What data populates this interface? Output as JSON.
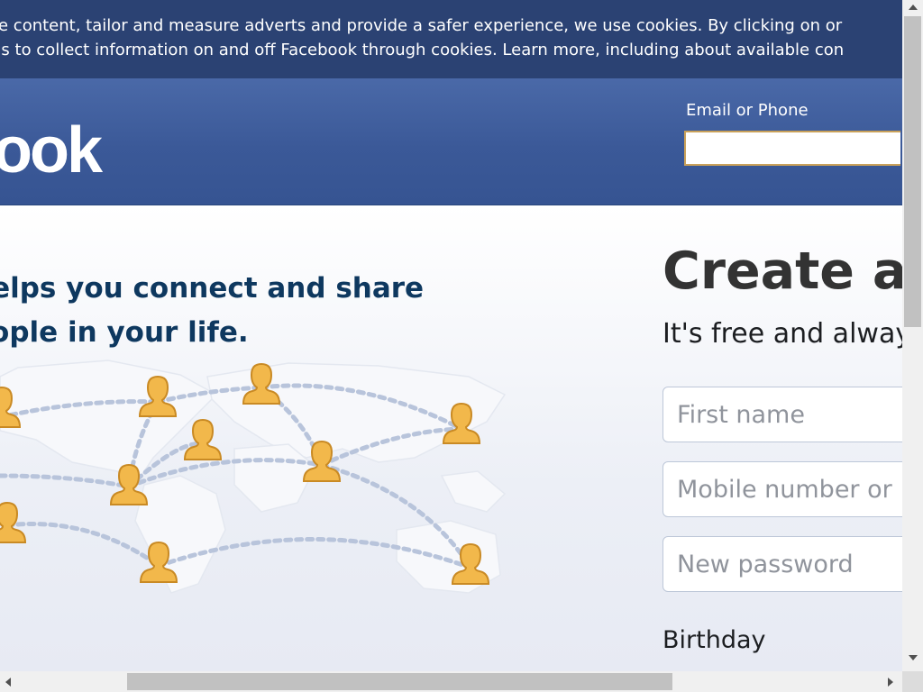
{
  "cookie_banner": {
    "line1": "e content, tailor and measure adverts and provide a safer experience, we use cookies. By clicking on or",
    "line2": "us to collect information on and off Facebook through cookies. Learn more, including about available con"
  },
  "header": {
    "logo_text": "ook",
    "email_label": "Email or Phone",
    "email_value": ""
  },
  "main": {
    "tagline": "helps you connect and share\neople in your life.",
    "illustration": "world-map-with-connected-people"
  },
  "signup": {
    "heading": "Create a",
    "subheading": "It's free and alway",
    "first_name_placeholder": "First name",
    "mobile_placeholder": "Mobile number or",
    "password_placeholder": "New password",
    "birthday_label": "Birthday"
  },
  "colors": {
    "banner_bg": "#2b4273",
    "header_bg": "#3b5998",
    "tagline": "#0e385f",
    "person_icon": "#f2b84b"
  }
}
